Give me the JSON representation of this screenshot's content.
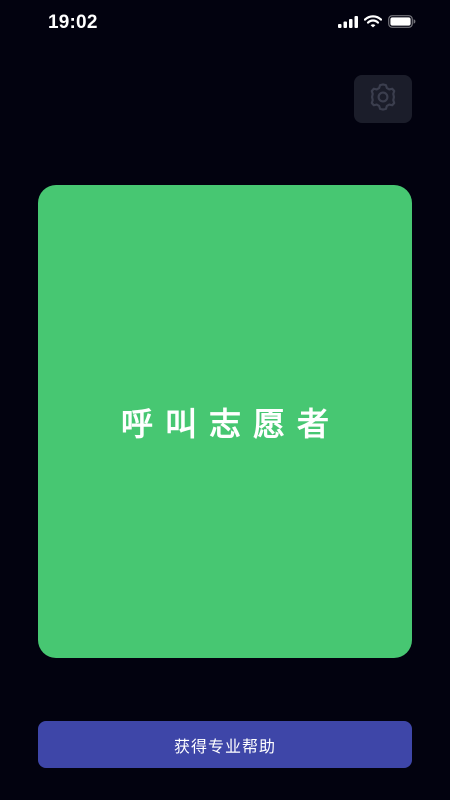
{
  "status_bar": {
    "time": "19:02",
    "icons": [
      "signal-icon",
      "wifi-icon",
      "battery-icon"
    ]
  },
  "settings": {
    "icon": "gear-icon"
  },
  "call_card": {
    "label": "呼叫志愿者",
    "color": "#47c772"
  },
  "help_button": {
    "label": "获得专业帮助",
    "color": "#3e46a8"
  },
  "theme": {
    "background": "#02020f"
  }
}
